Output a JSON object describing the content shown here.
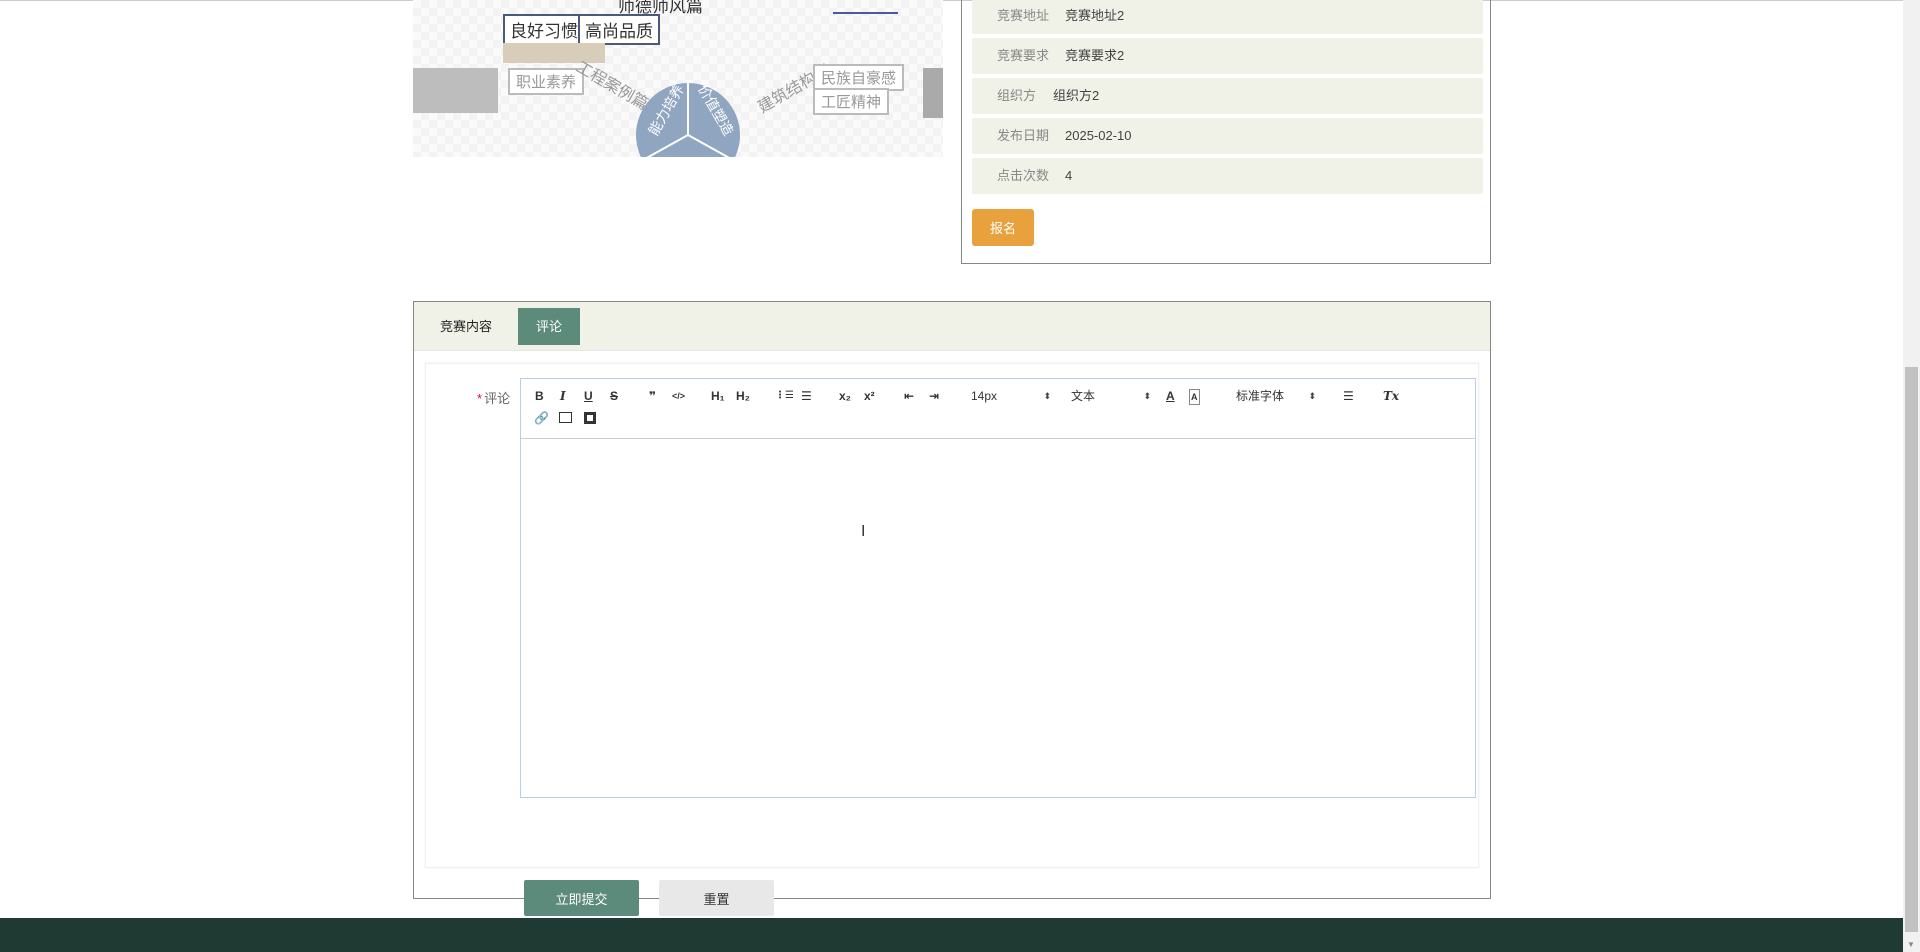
{
  "image_text": {
    "heading": "师德师风篇",
    "box1": "良好习惯",
    "box2": "高尚品质",
    "left_box": "职业素养",
    "left_curve": "工程案例篇",
    "right_curve": "建筑结构篇",
    "right_box1": "民族自豪感",
    "right_box2": "工匠精神",
    "segment1": "能力培养",
    "segment2": "价值塑造"
  },
  "info": {
    "rows": [
      {
        "label": "竞赛地址",
        "value": "竞赛地址2"
      },
      {
        "label": "竞赛要求",
        "value": "竞赛要求2"
      },
      {
        "label": "组织方",
        "value": "组织方2"
      },
      {
        "label": "发布日期",
        "value": "2025-02-10"
      },
      {
        "label": "点击次数",
        "value": "4"
      }
    ],
    "signup_label": "报名"
  },
  "tabs": [
    {
      "label": "竞赛内容",
      "active": false
    },
    {
      "label": "评论",
      "active": true
    }
  ],
  "form": {
    "required_mark": "*",
    "comment_label": "评论",
    "toolbar": {
      "bold": "B",
      "italic": "I",
      "underline": "U",
      "strike": "S",
      "blockquote": "❞",
      "code": "</>",
      "h1": "H₁",
      "h2": "H₂",
      "ordered_list": "⋮☰",
      "bullet_list": "☰",
      "subscript": "x₂",
      "superscript": "x²",
      "outdent": "⇤",
      "indent": "⇥",
      "size": "14px",
      "header": "文本",
      "font": "标准字体",
      "color": "A",
      "background": "A",
      "align": "☰",
      "clean": "Tx"
    },
    "submit_label": "立即提交",
    "reset_label": "重置"
  },
  "colors": {
    "accent": "#5c8a7b",
    "signup": "#e8a13c",
    "footer": "#1f3a32",
    "row_bg": "#f0f1e7"
  }
}
